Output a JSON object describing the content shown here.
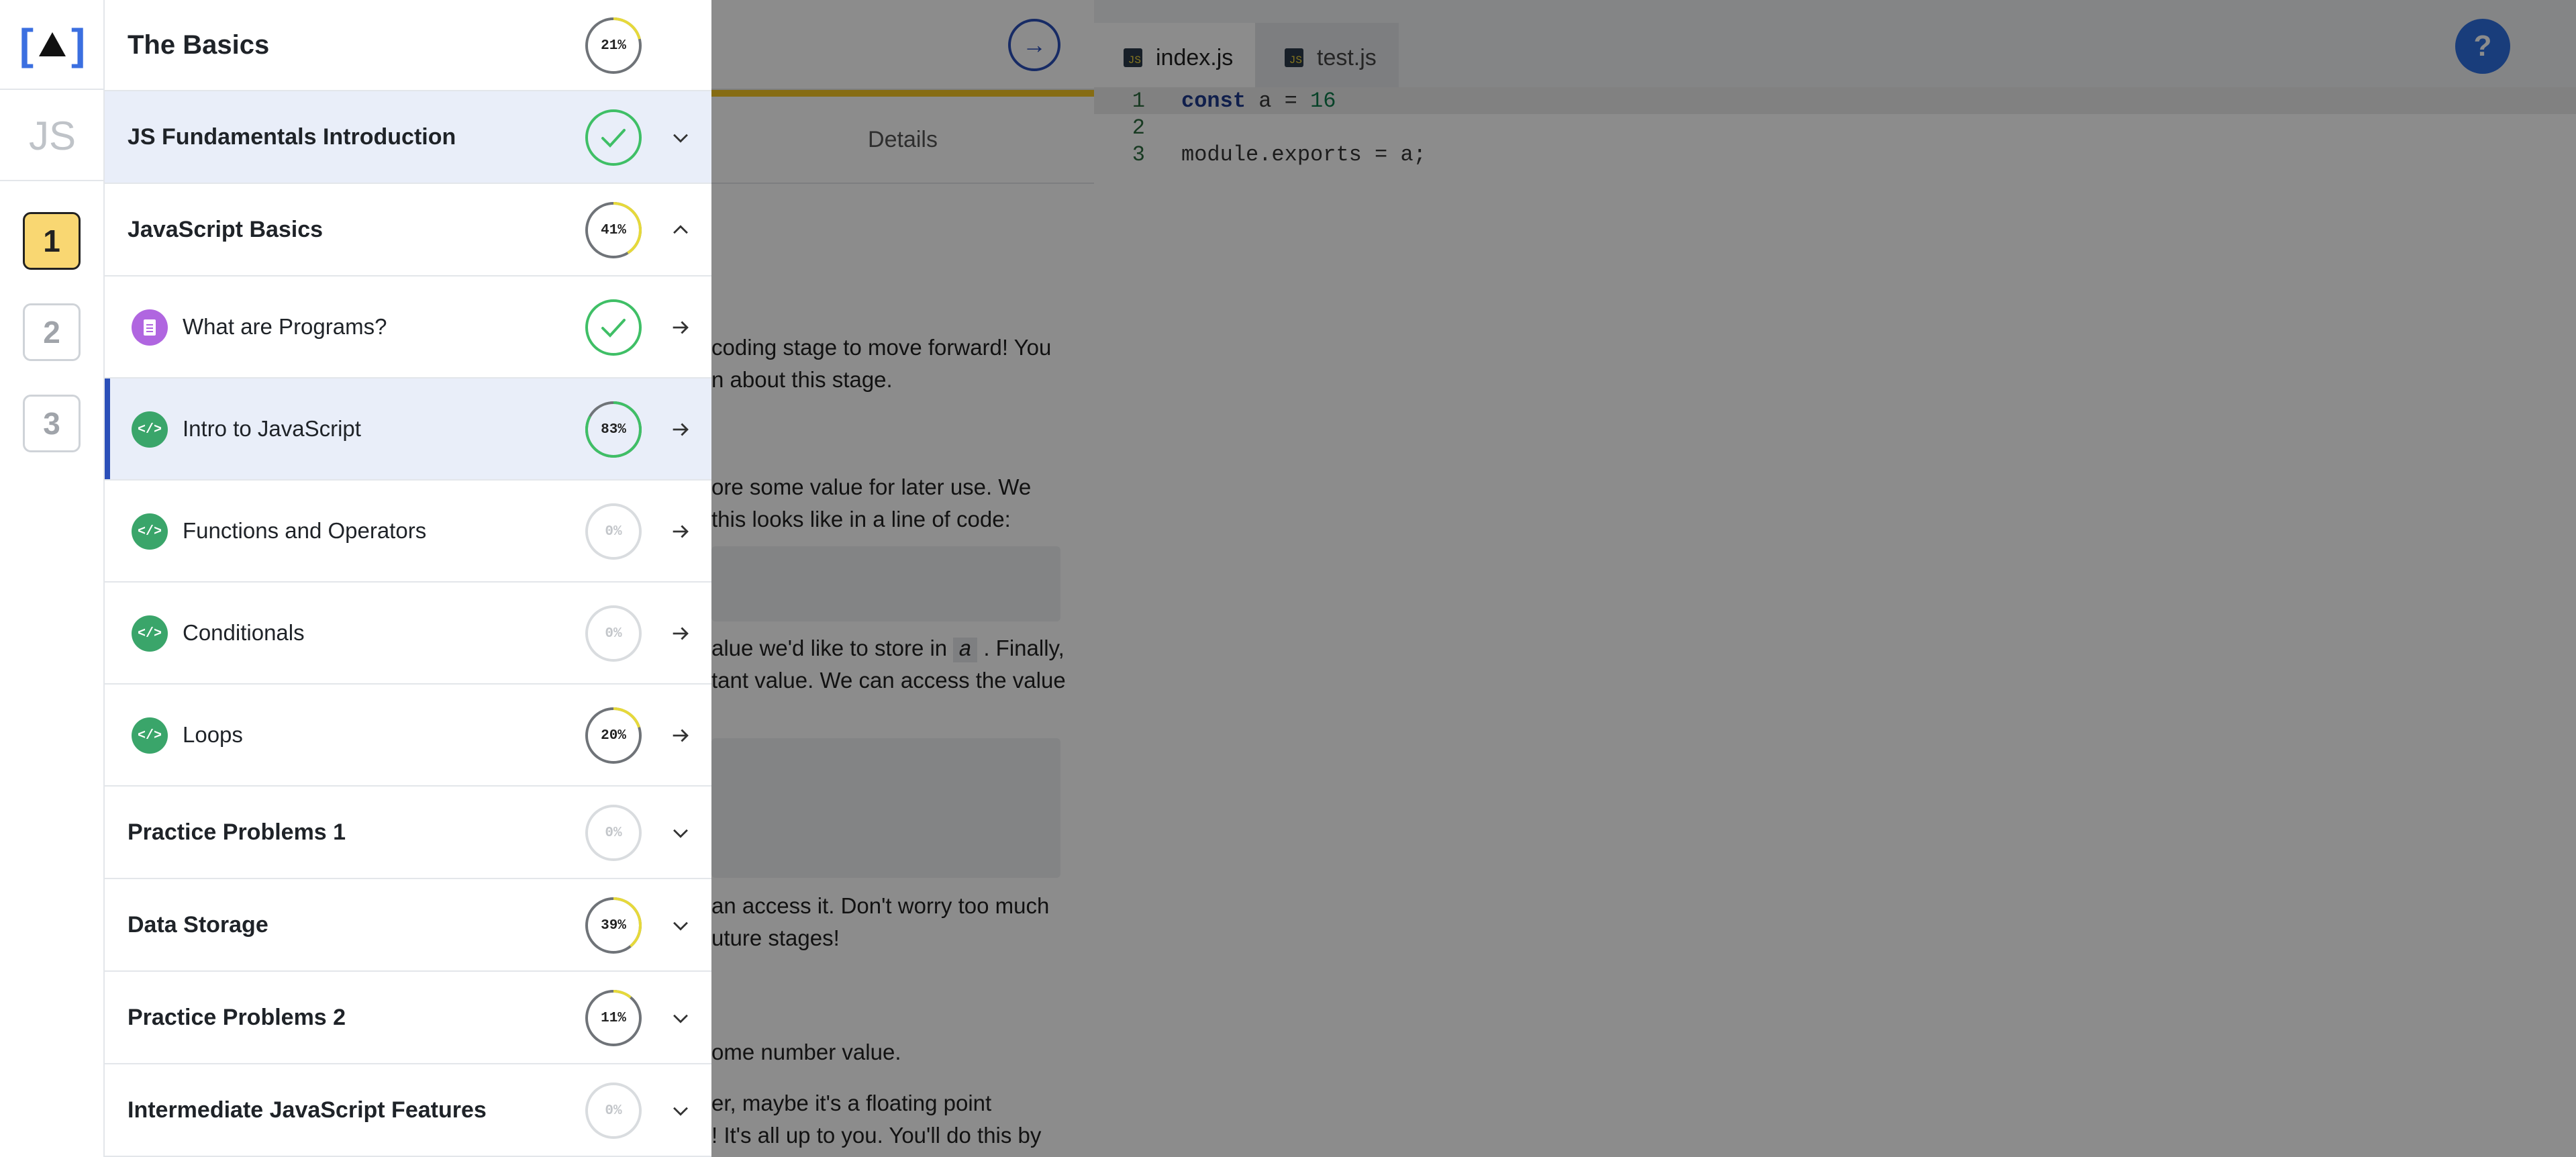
{
  "rail": {
    "logo_left": "[",
    "logo_right": "]",
    "language_label": "JS",
    "units": [
      "1",
      "2",
      "3"
    ],
    "active_unit": "1"
  },
  "nav": {
    "section_title": "The Basics",
    "section_progress": "21%",
    "modules": [
      {
        "title": "JS Fundamentals Introduction",
        "status": "complete",
        "progress": 1.0,
        "chevron": "chevron-down"
      },
      {
        "title": "JavaScript Basics",
        "status": "in-progress",
        "progress_label": "41%",
        "progress": 0.41,
        "chevron": "chevron-up",
        "lessons": [
          {
            "title": "What are Programs?",
            "type": "document",
            "status": "complete",
            "progress": 1.0
          },
          {
            "title": "Intro to JavaScript",
            "type": "code",
            "status": "in-progress",
            "progress_label": "83%",
            "progress": 0.83,
            "selected": true
          },
          {
            "title": "Functions and Operators",
            "type": "code",
            "status": "not-started",
            "progress_label": "0%",
            "progress": 0
          },
          {
            "title": "Conditionals",
            "type": "code",
            "status": "not-started",
            "progress_label": "0%",
            "progress": 0
          },
          {
            "title": "Loops",
            "type": "code",
            "status": "in-progress",
            "progress_label": "20%",
            "progress": 0.2
          }
        ]
      },
      {
        "title": "Practice Problems 1",
        "status": "not-started",
        "progress_label": "0%",
        "progress": 0,
        "chevron": "chevron-down"
      },
      {
        "title": "Data Storage",
        "status": "in-progress",
        "progress_label": "39%",
        "progress": 0.39,
        "chevron": "chevron-down"
      },
      {
        "title": "Practice Problems 2",
        "status": "in-progress",
        "progress_label": "11%",
        "progress": 0.11,
        "chevron": "chevron-down"
      },
      {
        "title": "Intermediate JavaScript Features",
        "status": "not-started",
        "progress_label": "0%",
        "progress": 0,
        "chevron": "chevron-down"
      }
    ]
  },
  "lesson": {
    "tab_label": "Details",
    "paragraphs": [
      "coding stage to move forward! You",
      "n about this stage.",
      "ore some value for later use. We",
      "this looks like in a line of code:",
      "alue we'd like to store in",
      ". Finally,",
      "tant value. We can access the value",
      "an access it. Don't worry too much",
      "uture stages!",
      "ome number value.",
      "er, maybe it's a floating point",
      "! It's all up to you. You'll do this by"
    ],
    "inline_var": "a"
  },
  "editor": {
    "tabs": [
      {
        "name": "index.js",
        "active": true
      },
      {
        "name": "test.js",
        "active": false
      }
    ],
    "badge": "JS",
    "help_label": "?",
    "lines": [
      {
        "num": "1",
        "keyword": "const",
        "rest": " a = ",
        "number": "16"
      },
      {
        "num": "2",
        "text": ""
      },
      {
        "num": "3",
        "text": "module.exports = a;"
      }
    ]
  },
  "colors": {
    "accent": "#2b4fb8",
    "complete": "#3fbf66",
    "progress_track": "#d9dcdf",
    "progress_fill_low": "#e6d93a",
    "progress_fill_high": "#3fbf66",
    "active_unit": "#f9d772",
    "lesson_code_icon": "#3aa56a",
    "lesson_doc_icon": "#b066e0"
  }
}
